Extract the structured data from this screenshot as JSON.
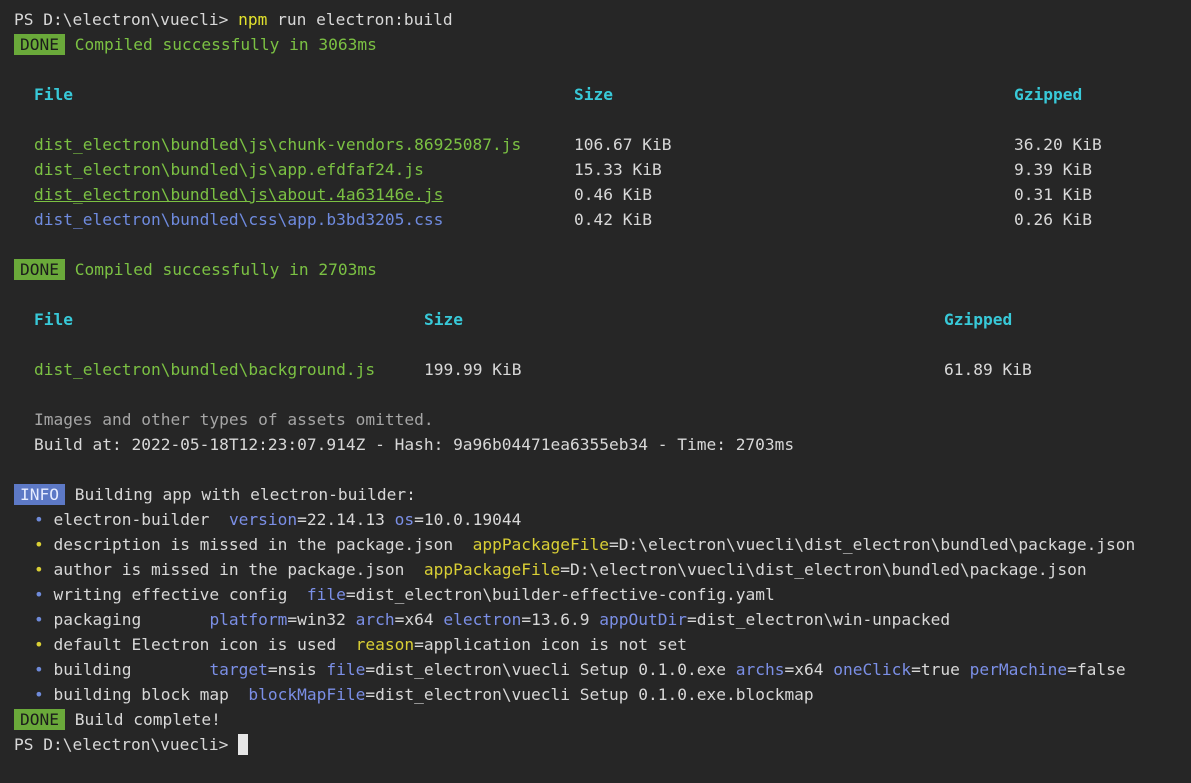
{
  "prompt": {
    "ps": "PS D:\\electron\\vuecli>",
    "cmd_npm": "npm",
    "cmd_rest": "run electron:build"
  },
  "badges": {
    "done": "DONE",
    "info": "INFO"
  },
  "build1": {
    "compiled": "Compiled successfully in 3063ms",
    "headers": {
      "file": "File",
      "size": "Size",
      "gzip": "Gzipped"
    },
    "rows": [
      {
        "file": "dist_electron\\bundled\\js\\chunk-vendors.86925087.js",
        "size": "106.67 KiB",
        "gzip": "36.20 KiB"
      },
      {
        "file": "dist_electron\\bundled\\js\\app.efdfaf24.js",
        "size": "15.33 KiB",
        "gzip": "9.39 KiB"
      },
      {
        "file": "dist_electron\\bundled\\js\\about.4a63146e.js",
        "size": "0.46 KiB",
        "gzip": "0.31 KiB"
      },
      {
        "file": "dist_electron\\bundled\\css\\app.b3bd3205.css",
        "size": "0.42 KiB",
        "gzip": "0.26 KiB"
      }
    ]
  },
  "build2": {
    "compiled": "Compiled successfully in 2703ms",
    "headers": {
      "file": "File",
      "size": "Size",
      "gzip": "Gzipped"
    },
    "rows": [
      {
        "file": "dist_electron\\bundled\\background.js",
        "size": "199.99 KiB",
        "gzip": "61.89 KiB"
      }
    ],
    "omitted": "Images and other types of assets omitted.",
    "build_at": "Build at: 2022-05-18T12:23:07.914Z - Hash: 9a96b04471ea6355eb34 - Time: 2703ms"
  },
  "info": {
    "text": "Building app with electron-builder:",
    "bullet": "•",
    "items": [
      {
        "label": "electron-builder  ",
        "parts": [
          [
            "version",
            "=22.14.13 "
          ],
          [
            "os",
            "=10.0.19044"
          ]
        ]
      },
      {
        "label": "description is missed in the package.json  ",
        "parts": [
          [
            "appPackageFile",
            "=D:\\electron\\vuecli\\dist_electron\\bundled\\package.json"
          ]
        ]
      },
      {
        "label": "author is missed in the package.json  ",
        "parts": [
          [
            "appPackageFile",
            "=D:\\electron\\vuecli\\dist_electron\\bundled\\package.json"
          ]
        ]
      },
      {
        "label": "writing effective config  ",
        "parts": [
          [
            "file",
            "=dist_electron\\builder-effective-config.yaml"
          ]
        ]
      },
      {
        "label": "packaging       ",
        "parts": [
          [
            "platform",
            "=win32 "
          ],
          [
            "arch",
            "=x64 "
          ],
          [
            "electron",
            "=13.6.9 "
          ],
          [
            "appOutDir",
            "=dist_electron\\win-unpacked"
          ]
        ]
      },
      {
        "label": "default Electron icon is used  ",
        "parts": [
          [
            "reason",
            "=application icon is not set"
          ]
        ]
      },
      {
        "label": "building        ",
        "parts": [
          [
            "target",
            "=nsis "
          ],
          [
            "file",
            "=dist_electron\\vuecli Setup 0.1.0.exe "
          ],
          [
            "archs",
            "=x64 "
          ],
          [
            "oneClick",
            "=true "
          ],
          [
            "perMachine",
            "=false"
          ]
        ]
      },
      {
        "label": "building block map  ",
        "parts": [
          [
            "blockMapFile",
            "=dist_electron\\vuecli Setup 0.1.0.exe.blockmap"
          ]
        ]
      }
    ]
  },
  "complete": "Build complete!",
  "colors": {
    "background": "#262626",
    "done_badge": "#6aa93a",
    "info_badge": "#5d79c6",
    "success": "#7bc143",
    "header": "#38c9d8",
    "key_blue": "#7b8fe6",
    "key_yellow": "#d9cf35"
  }
}
